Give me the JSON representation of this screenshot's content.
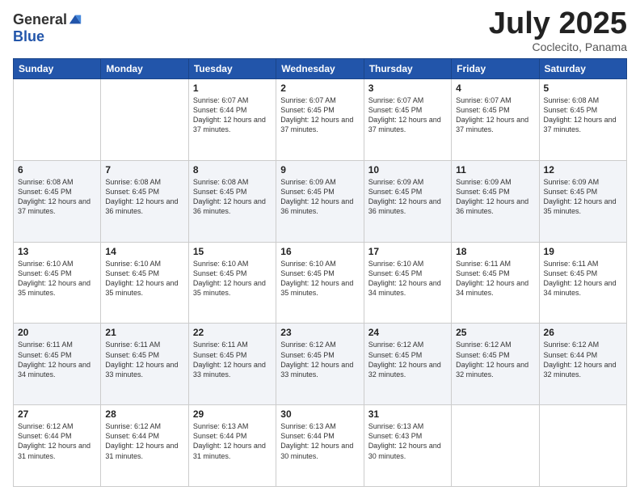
{
  "header": {
    "logo_general": "General",
    "logo_blue": "Blue",
    "title": "July 2025",
    "location": "Coclecito, Panama"
  },
  "days_of_week": [
    "Sunday",
    "Monday",
    "Tuesday",
    "Wednesday",
    "Thursday",
    "Friday",
    "Saturday"
  ],
  "weeks": [
    [
      {
        "day": "",
        "sunrise": "",
        "sunset": "",
        "daylight": ""
      },
      {
        "day": "",
        "sunrise": "",
        "sunset": "",
        "daylight": ""
      },
      {
        "day": "1",
        "sunrise": "Sunrise: 6:07 AM",
        "sunset": "Sunset: 6:44 PM",
        "daylight": "Daylight: 12 hours and 37 minutes."
      },
      {
        "day": "2",
        "sunrise": "Sunrise: 6:07 AM",
        "sunset": "Sunset: 6:45 PM",
        "daylight": "Daylight: 12 hours and 37 minutes."
      },
      {
        "day": "3",
        "sunrise": "Sunrise: 6:07 AM",
        "sunset": "Sunset: 6:45 PM",
        "daylight": "Daylight: 12 hours and 37 minutes."
      },
      {
        "day": "4",
        "sunrise": "Sunrise: 6:07 AM",
        "sunset": "Sunset: 6:45 PM",
        "daylight": "Daylight: 12 hours and 37 minutes."
      },
      {
        "day": "5",
        "sunrise": "Sunrise: 6:08 AM",
        "sunset": "Sunset: 6:45 PM",
        "daylight": "Daylight: 12 hours and 37 minutes."
      }
    ],
    [
      {
        "day": "6",
        "sunrise": "Sunrise: 6:08 AM",
        "sunset": "Sunset: 6:45 PM",
        "daylight": "Daylight: 12 hours and 37 minutes."
      },
      {
        "day": "7",
        "sunrise": "Sunrise: 6:08 AM",
        "sunset": "Sunset: 6:45 PM",
        "daylight": "Daylight: 12 hours and 36 minutes."
      },
      {
        "day": "8",
        "sunrise": "Sunrise: 6:08 AM",
        "sunset": "Sunset: 6:45 PM",
        "daylight": "Daylight: 12 hours and 36 minutes."
      },
      {
        "day": "9",
        "sunrise": "Sunrise: 6:09 AM",
        "sunset": "Sunset: 6:45 PM",
        "daylight": "Daylight: 12 hours and 36 minutes."
      },
      {
        "day": "10",
        "sunrise": "Sunrise: 6:09 AM",
        "sunset": "Sunset: 6:45 PM",
        "daylight": "Daylight: 12 hours and 36 minutes."
      },
      {
        "day": "11",
        "sunrise": "Sunrise: 6:09 AM",
        "sunset": "Sunset: 6:45 PM",
        "daylight": "Daylight: 12 hours and 36 minutes."
      },
      {
        "day": "12",
        "sunrise": "Sunrise: 6:09 AM",
        "sunset": "Sunset: 6:45 PM",
        "daylight": "Daylight: 12 hours and 35 minutes."
      }
    ],
    [
      {
        "day": "13",
        "sunrise": "Sunrise: 6:10 AM",
        "sunset": "Sunset: 6:45 PM",
        "daylight": "Daylight: 12 hours and 35 minutes."
      },
      {
        "day": "14",
        "sunrise": "Sunrise: 6:10 AM",
        "sunset": "Sunset: 6:45 PM",
        "daylight": "Daylight: 12 hours and 35 minutes."
      },
      {
        "day": "15",
        "sunrise": "Sunrise: 6:10 AM",
        "sunset": "Sunset: 6:45 PM",
        "daylight": "Daylight: 12 hours and 35 minutes."
      },
      {
        "day": "16",
        "sunrise": "Sunrise: 6:10 AM",
        "sunset": "Sunset: 6:45 PM",
        "daylight": "Daylight: 12 hours and 35 minutes."
      },
      {
        "day": "17",
        "sunrise": "Sunrise: 6:10 AM",
        "sunset": "Sunset: 6:45 PM",
        "daylight": "Daylight: 12 hours and 34 minutes."
      },
      {
        "day": "18",
        "sunrise": "Sunrise: 6:11 AM",
        "sunset": "Sunset: 6:45 PM",
        "daylight": "Daylight: 12 hours and 34 minutes."
      },
      {
        "day": "19",
        "sunrise": "Sunrise: 6:11 AM",
        "sunset": "Sunset: 6:45 PM",
        "daylight": "Daylight: 12 hours and 34 minutes."
      }
    ],
    [
      {
        "day": "20",
        "sunrise": "Sunrise: 6:11 AM",
        "sunset": "Sunset: 6:45 PM",
        "daylight": "Daylight: 12 hours and 34 minutes."
      },
      {
        "day": "21",
        "sunrise": "Sunrise: 6:11 AM",
        "sunset": "Sunset: 6:45 PM",
        "daylight": "Daylight: 12 hours and 33 minutes."
      },
      {
        "day": "22",
        "sunrise": "Sunrise: 6:11 AM",
        "sunset": "Sunset: 6:45 PM",
        "daylight": "Daylight: 12 hours and 33 minutes."
      },
      {
        "day": "23",
        "sunrise": "Sunrise: 6:12 AM",
        "sunset": "Sunset: 6:45 PM",
        "daylight": "Daylight: 12 hours and 33 minutes."
      },
      {
        "day": "24",
        "sunrise": "Sunrise: 6:12 AM",
        "sunset": "Sunset: 6:45 PM",
        "daylight": "Daylight: 12 hours and 32 minutes."
      },
      {
        "day": "25",
        "sunrise": "Sunrise: 6:12 AM",
        "sunset": "Sunset: 6:45 PM",
        "daylight": "Daylight: 12 hours and 32 minutes."
      },
      {
        "day": "26",
        "sunrise": "Sunrise: 6:12 AM",
        "sunset": "Sunset: 6:44 PM",
        "daylight": "Daylight: 12 hours and 32 minutes."
      }
    ],
    [
      {
        "day": "27",
        "sunrise": "Sunrise: 6:12 AM",
        "sunset": "Sunset: 6:44 PM",
        "daylight": "Daylight: 12 hours and 31 minutes."
      },
      {
        "day": "28",
        "sunrise": "Sunrise: 6:12 AM",
        "sunset": "Sunset: 6:44 PM",
        "daylight": "Daylight: 12 hours and 31 minutes."
      },
      {
        "day": "29",
        "sunrise": "Sunrise: 6:13 AM",
        "sunset": "Sunset: 6:44 PM",
        "daylight": "Daylight: 12 hours and 31 minutes."
      },
      {
        "day": "30",
        "sunrise": "Sunrise: 6:13 AM",
        "sunset": "Sunset: 6:44 PM",
        "daylight": "Daylight: 12 hours and 30 minutes."
      },
      {
        "day": "31",
        "sunrise": "Sunrise: 6:13 AM",
        "sunset": "Sunset: 6:43 PM",
        "daylight": "Daylight: 12 hours and 30 minutes."
      },
      {
        "day": "",
        "sunrise": "",
        "sunset": "",
        "daylight": ""
      },
      {
        "day": "",
        "sunrise": "",
        "sunset": "",
        "daylight": ""
      }
    ]
  ]
}
